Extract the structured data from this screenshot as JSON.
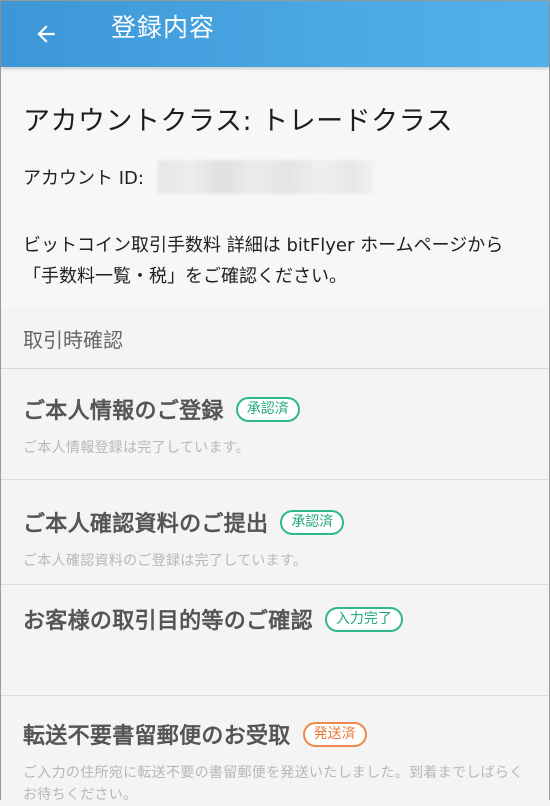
{
  "header": {
    "back_icon": "arrow-left-icon",
    "title": "登録内容",
    "background": "#4aa8e4"
  },
  "account": {
    "class_label": "アカウントクラス: トレードクラス",
    "id_label": "アカウント ID:",
    "id_value": "",
    "fee_note": "ビットコイン取引手数料 詳細は bitFlyer ホームページから「手数料一覧・税」をご確認ください。"
  },
  "section": {
    "header": "取引時確認"
  },
  "items": [
    {
      "title": "ご本人情報のご登録",
      "badge": "承認済",
      "badge_color": "#2fb88a",
      "subtitle": "ご本人情報登録は完了しています。"
    },
    {
      "title": "ご本人確認資料のご提出",
      "badge": "承認済",
      "badge_color": "#2fb88a",
      "subtitle": "ご本人確認資料のご登録は完了しています。"
    },
    {
      "title": "お客様の取引目的等のご確認",
      "badge": "入力完了",
      "badge_color": "#2fb88a",
      "subtitle": ""
    },
    {
      "title": "転送不要書留郵便のお受取",
      "badge": "発送済",
      "badge_color": "#ef8a4c",
      "subtitle": "ご入力の住所宛に転送不要の書留郵便を発送いたしました。到着までしばらくお待ちください。"
    }
  ]
}
